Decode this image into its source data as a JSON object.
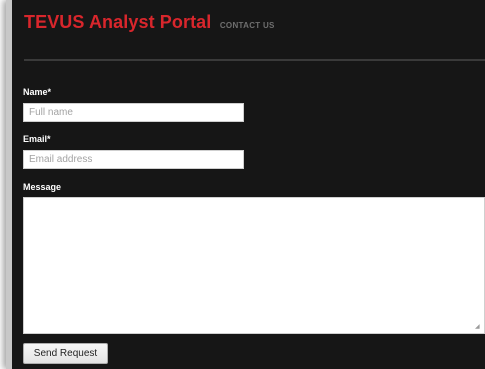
{
  "header": {
    "title": "TEVUS Analyst Portal",
    "contact_link": "CONTACT US"
  },
  "form": {
    "name_label": "Name*",
    "name_placeholder": "Full name",
    "email_label": "Email*",
    "email_placeholder": "Email address",
    "message_label": "Message",
    "submit_label": "Send Request"
  },
  "colors": {
    "title": "#d8262c",
    "background": "#161616",
    "link": "#6f6f6f"
  },
  "icons": {
    "textarea_resize": "resize-grip-icon"
  }
}
